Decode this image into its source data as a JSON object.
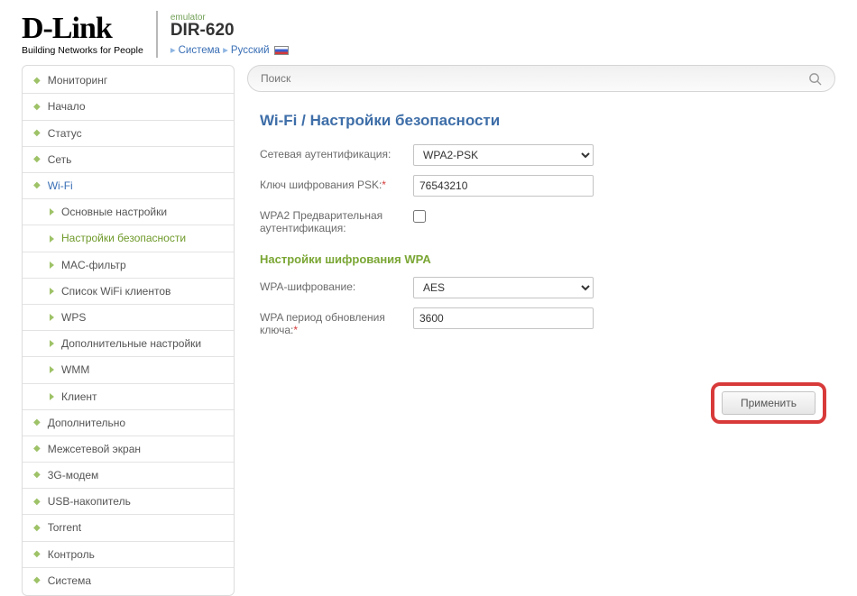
{
  "header": {
    "logo_main": "D-Link",
    "logo_tag": "Building Networks for People",
    "emulator": "emulator",
    "model": "DIR-620",
    "crumbs": {
      "system": "Система",
      "lang": "Русский"
    }
  },
  "search": {
    "placeholder": "Поиск"
  },
  "sidebar": {
    "items": [
      "Мониторинг",
      "Начало",
      "Статус",
      "Сеть",
      "Wi-Fi",
      "Дополнительно",
      "Межсетевой экран",
      "3G-модем",
      "USB-накопитель",
      "Torrent",
      "Контроль",
      "Система"
    ],
    "wifi_sub": [
      "Основные настройки",
      "Настройки безопасности",
      "MAC-фильтр",
      "Список WiFi клиентов",
      "WPS",
      "Дополнительные настройки",
      "WMM",
      "Клиент"
    ]
  },
  "page": {
    "title_root": "Wi-Fi",
    "title_leaf": "Настройки безопасности",
    "fields": {
      "auth_label": "Сетевая аутентификация:",
      "auth_value": "WPA2-PSK",
      "psk_label": "Ключ шифрования PSK:",
      "psk_value": "76543210",
      "preauth_label": "WPA2 Предварительная аутентификация:",
      "wpa_section": "Настройки шифрования WPA",
      "enc_label": "WPA-шифрование:",
      "enc_value": "AES",
      "rekey_label": "WPA период обновления ключа:",
      "rekey_value": "3600"
    },
    "apply": "Применить"
  }
}
